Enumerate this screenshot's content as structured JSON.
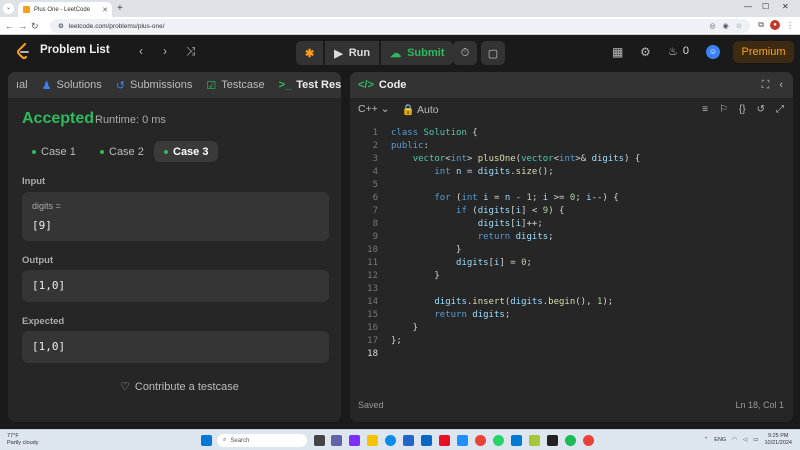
{
  "browser": {
    "tab_title": "Plus One - LeetCode",
    "url": "leetcode.com/problems/plus-one/"
  },
  "topbar": {
    "problem_list": "Problem List",
    "run": "Run",
    "submit": "Submit",
    "streak": "0",
    "premium": "Premium"
  },
  "left_panel": {
    "tabs": [
      "Solutions",
      "Submissions",
      "Testcase",
      "Test Result"
    ],
    "status": "Accepted",
    "runtime": "Runtime: 0 ms",
    "cases": [
      "Case 1",
      "Case 2",
      "Case 3"
    ],
    "input_label": "Input",
    "input_var": "digits =",
    "input_value": "[9]",
    "output_label": "Output",
    "output_value": "[1,0]",
    "expected_label": "Expected",
    "expected_value": "[1,0]",
    "contribute": "Contribute a testcase"
  },
  "editor": {
    "title": "Code",
    "language": "C++",
    "mode": "Auto",
    "status": "Saved",
    "cursor": "Ln 18, Col 1",
    "lines": [
      "class Solution {",
      "public:",
      "    vector<int> plusOne(vector<int>& digits) {",
      "        int n = digits.size();",
      "",
      "        for (int i = n - 1; i >= 0; i--) {",
      "            if (digits[i] < 9) {",
      "                digits[i]++;",
      "                return digits;",
      "            }",
      "            digits[i] = 0;",
      "        }",
      "",
      "        digits.insert(digits.begin(), 1);",
      "        return digits;",
      "    }",
      "};",
      ""
    ]
  },
  "taskbar": {
    "temp": "77°F",
    "weather": "Partly cloudy",
    "search": "Search",
    "lang": "ENG",
    "time": "9:25 PM",
    "date": "10/21/2024"
  }
}
